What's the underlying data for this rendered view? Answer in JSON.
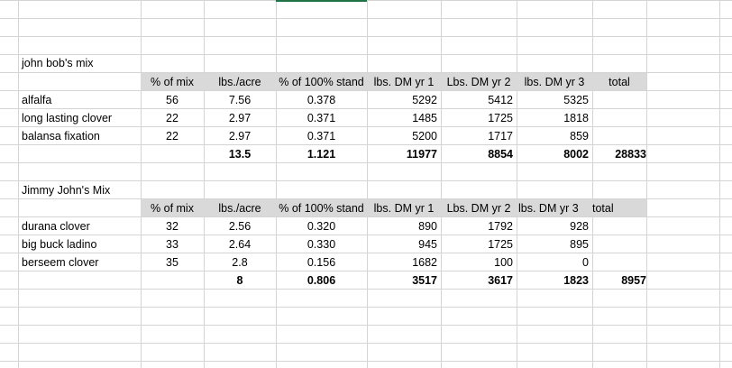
{
  "sheet": {
    "colors": {
      "gridline": "#d4d4d4",
      "header_fill": "#d9d9d9",
      "selection": "#217346"
    },
    "tables": [
      {
        "title": "john bob's mix",
        "headers": [
          "% of mix",
          "lbs./acre",
          "% of 100% stand",
          "lbs. DM yr 1",
          "Lbs. DM yr 2",
          "lbs. DM yr 3",
          "total"
        ],
        "rows": [
          {
            "name": "alfalfa",
            "values": [
              "56",
              "7.56",
              "0.378",
              "5292",
              "5412",
              "5325",
              ""
            ]
          },
          {
            "name": "long lasting clover",
            "values": [
              "22",
              "2.97",
              "0.371",
              "1485",
              "1725",
              "1818",
              ""
            ]
          },
          {
            "name": "balansa fixation",
            "values": [
              "22",
              "2.97",
              "0.371",
              "5200",
              "1717",
              "859",
              ""
            ]
          }
        ],
        "totals": [
          "",
          "13.5",
          "1.121",
          "11977",
          "8854",
          "8002",
          "28833"
        ]
      },
      {
        "title": "Jimmy John's Mix",
        "headers": [
          "% of mix",
          "lbs./acre",
          "% of 100% stand",
          "lbs. DM yr 1",
          "Lbs. DM yr 2",
          "lbs. DM yr 3",
          "total"
        ],
        "rows": [
          {
            "name": "durana clover",
            "values": [
              "32",
              "2.56",
              "0.320",
              "890",
              "1792",
              "928",
              ""
            ]
          },
          {
            "name": "big buck ladino",
            "values": [
              "33",
              "2.64",
              "0.330",
              "945",
              "1725",
              "895",
              ""
            ]
          },
          {
            "name": "berseem clover",
            "values": [
              "35",
              "2.8",
              "0.156",
              "1682",
              "100",
              "0",
              ""
            ]
          }
        ],
        "totals": [
          "",
          "8",
          "0.806",
          "3517",
          "3617",
          "1823",
          "8957"
        ]
      }
    ]
  }
}
